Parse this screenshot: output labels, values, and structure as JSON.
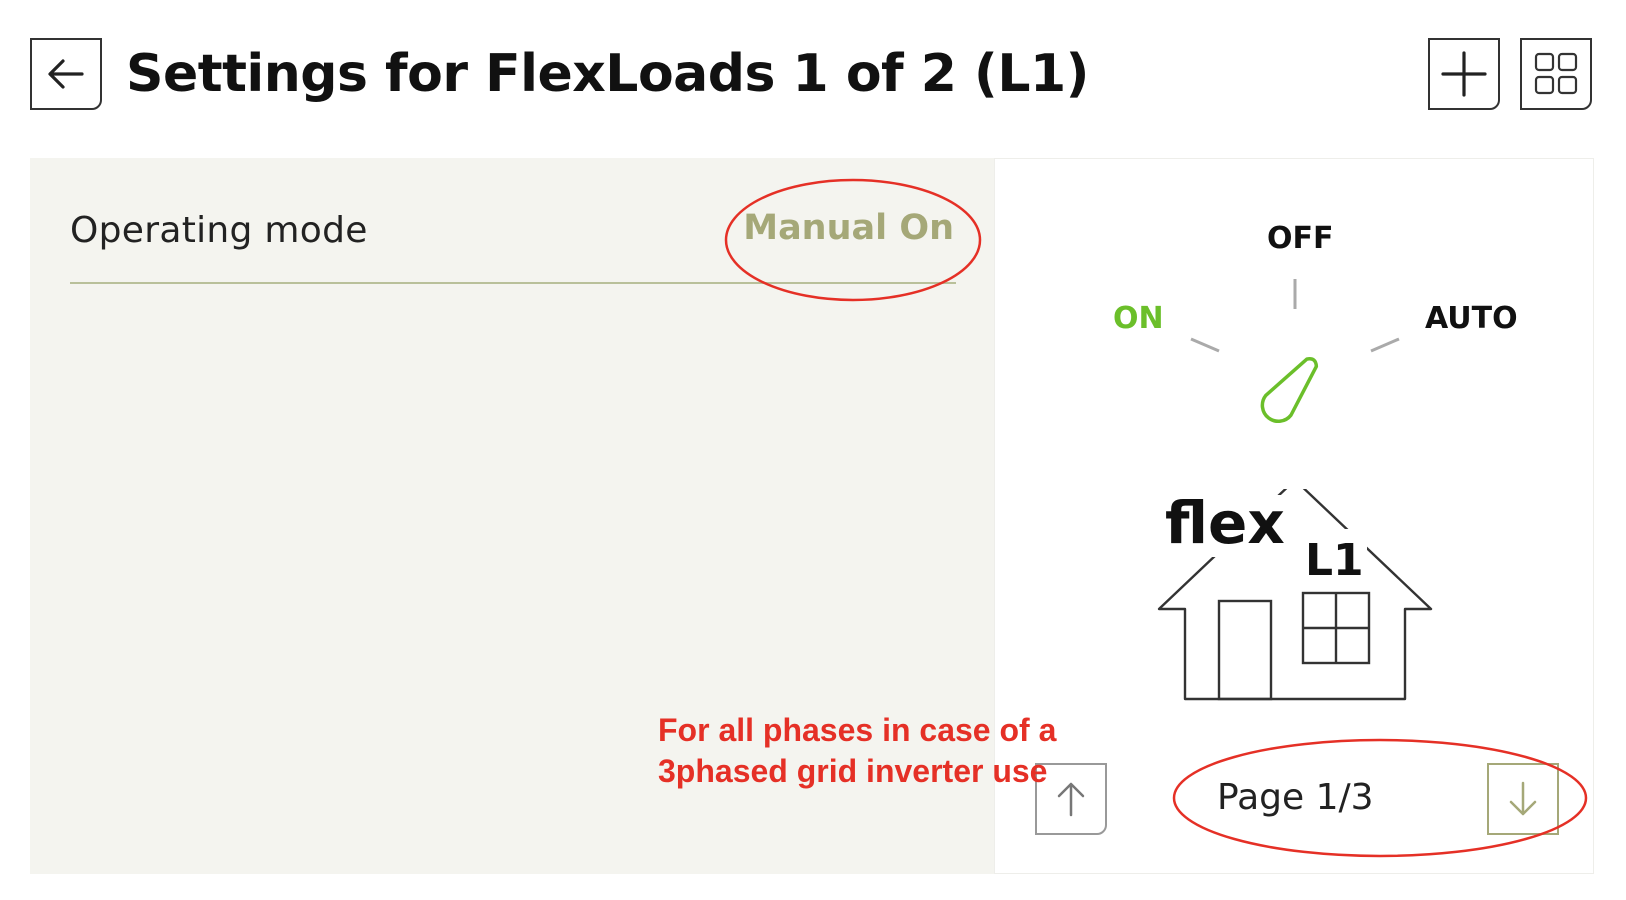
{
  "header": {
    "title": "Settings for FlexLoads 1 of 2 (L1)",
    "back_icon": "arrow-left-icon",
    "add_icon": "plus-icon",
    "grid_icon": "grid-icon"
  },
  "settings": {
    "operating_mode_label": "Operating mode",
    "operating_mode_value": "Manual On"
  },
  "dial": {
    "label_off": "OFF",
    "label_on": "ON",
    "label_auto": "AUTO",
    "selected": "ON",
    "active_color": "#6bbf2a"
  },
  "device_icon": {
    "text_main": "flex",
    "text_phase": "L1",
    "icon": "house-icon"
  },
  "pagination": {
    "page_label": "Page 1/3",
    "up_icon": "arrow-up-icon",
    "down_icon": "arrow-down-icon"
  },
  "annotation": {
    "note": "For all phases in case of a 3phased grid inverter use",
    "color": "#e53026"
  },
  "colors": {
    "panel_bg": "#f4f4ef",
    "accent_olive": "#a5a878"
  }
}
